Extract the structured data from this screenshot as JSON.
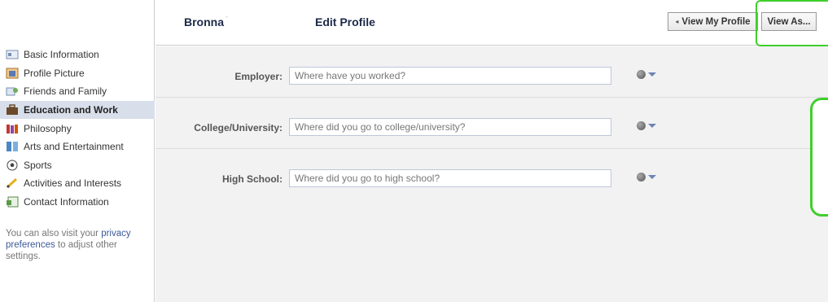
{
  "header": {
    "profile_name": "Bronna",
    "profile_name_mark": "'",
    "page_title": "Edit Profile",
    "view_profile_arrow": "◂",
    "view_profile_label": "View My Profile",
    "view_as_label": "View As..."
  },
  "sidebar": {
    "items": [
      {
        "label": "Basic Information",
        "icon": "id-card-icon",
        "active": false
      },
      {
        "label": "Profile Picture",
        "icon": "picture-icon",
        "active": false
      },
      {
        "label": "Friends and Family",
        "icon": "friends-icon",
        "active": false
      },
      {
        "label": "Education and Work",
        "icon": "briefcase-icon",
        "active": true
      },
      {
        "label": "Philosophy",
        "icon": "books-icon",
        "active": false
      },
      {
        "label": "Arts and Entertainment",
        "icon": "film-icon",
        "active": false
      },
      {
        "label": "Sports",
        "icon": "soccer-ball-icon",
        "active": false
      },
      {
        "label": "Activities and Interests",
        "icon": "pencil-icon",
        "active": false
      },
      {
        "label": "Contact Information",
        "icon": "contact-card-icon",
        "active": false
      }
    ],
    "note_prefix": "You can also visit your ",
    "note_link": "privacy preferences",
    "note_suffix": " to adjust other settings."
  },
  "form": {
    "fields": [
      {
        "label": "Employer:",
        "placeholder": "Where have you worked?"
      },
      {
        "label": "College/University:",
        "placeholder": "Where did you go to college/university?"
      },
      {
        "label": "High School:",
        "placeholder": "Where did you go to high school?"
      }
    ]
  },
  "colors": {
    "accent": "#3b5998",
    "highlight": "#3fcf2c",
    "active_row": "#d8dfea"
  }
}
